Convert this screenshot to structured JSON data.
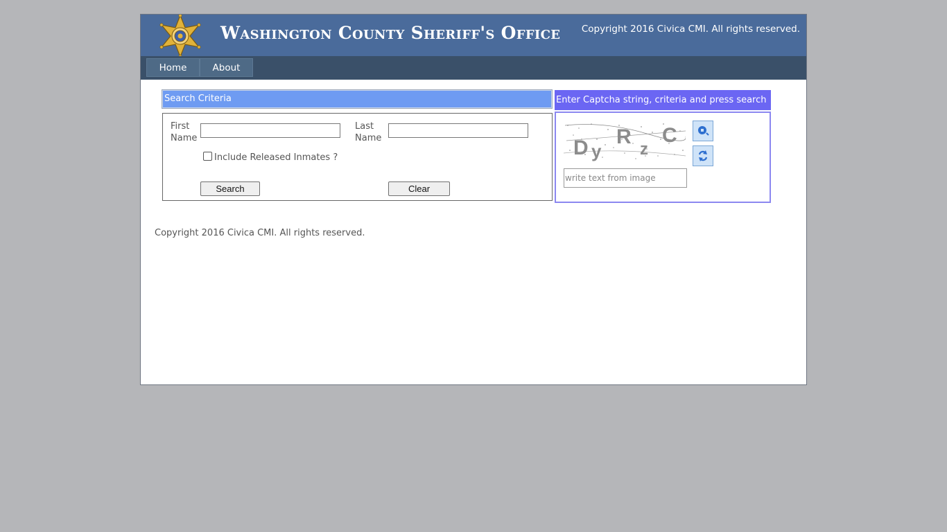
{
  "header": {
    "title": "Washington County Sheriff's Office",
    "copyright": "Copyright 2016 Civica CMI. All rights reserved."
  },
  "nav": {
    "home": "Home",
    "about": "About"
  },
  "search": {
    "heading": "Search Criteria",
    "first_name_label": "First Name",
    "last_name_label": "Last Name",
    "first_name_value": "",
    "last_name_value": "",
    "include_released_label": "Include Released Inmates ?",
    "include_released_checked": false,
    "search_button": "Search",
    "clear_button": "Clear"
  },
  "captcha": {
    "heading": "Enter Captcha string, criteria and press search",
    "image_text": "DyRzC",
    "input_placeholder": "write text from image",
    "listen_icon": "audio-icon",
    "refresh_icon": "refresh-icon"
  },
  "footer": {
    "copyright": "Copyright 2016 Civica CMI. All rights reserved."
  },
  "colors": {
    "background": "#b5b6b9",
    "header": "#4a6b9b",
    "nav": "#3a5069",
    "search_head": "#6e9bf2",
    "captcha_head": "#6b66f3"
  }
}
